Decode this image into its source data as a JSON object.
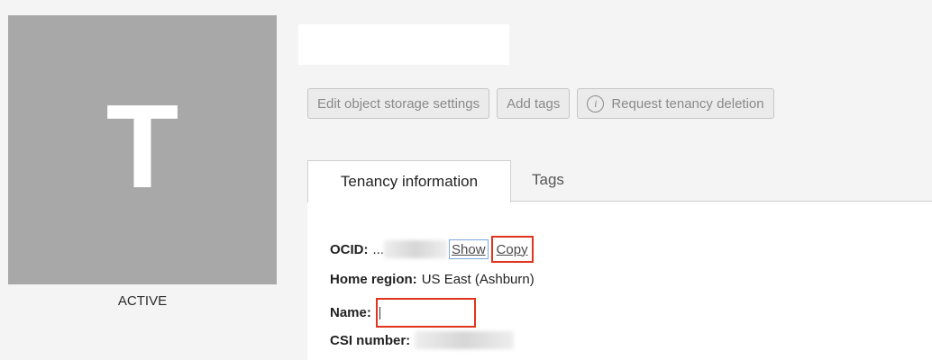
{
  "avatar": {
    "letter": "T"
  },
  "status": "ACTIVE",
  "actions": {
    "edit_storage": "Edit object storage settings",
    "add_tags": "Add tags",
    "request_deletion": "Request tenancy deletion"
  },
  "tabs": [
    {
      "label": "Tenancy information",
      "active": true
    },
    {
      "label": "Tags",
      "active": false
    }
  ],
  "info": {
    "ocid_label": "OCID:",
    "ocid_value": "...",
    "show_link": "Show",
    "copy_link": "Copy",
    "home_region_label": "Home region:",
    "home_region_value": "US East (Ashburn)",
    "name_label": "Name:",
    "csi_label": "CSI number:"
  },
  "colors": {
    "highlight_red": "#e0341c",
    "focus_blue": "#7aa6dc",
    "avatar_bg": "#a8a8a8"
  },
  "icons": {
    "request_deletion": "info-icon"
  }
}
